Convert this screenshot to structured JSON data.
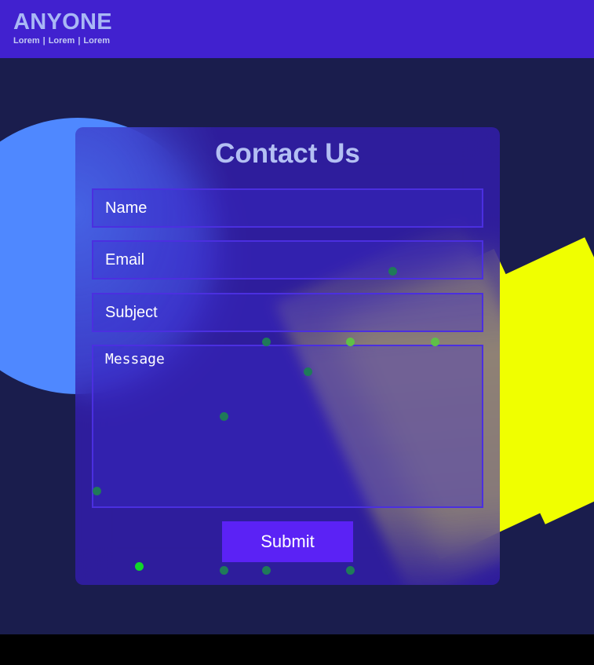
{
  "header": {
    "brand": "ANYONE",
    "nav": [
      "Lorem",
      "Lorem",
      "Lorem"
    ],
    "separator": "|",
    "background": "#4121cf"
  },
  "form": {
    "title": "Contact Us",
    "name_placeholder": "Name",
    "email_placeholder": "Email",
    "subject_placeholder": "Subject",
    "message_placeholder": "Message",
    "submit_label": "Submit"
  },
  "colors": {
    "page_bg": "#1a1d4d",
    "card_bg": "#351db2",
    "button": "#5b22f5",
    "circle": "#4f88ff",
    "polygon": "#f0ff00",
    "dots": "#1f7a59"
  }
}
